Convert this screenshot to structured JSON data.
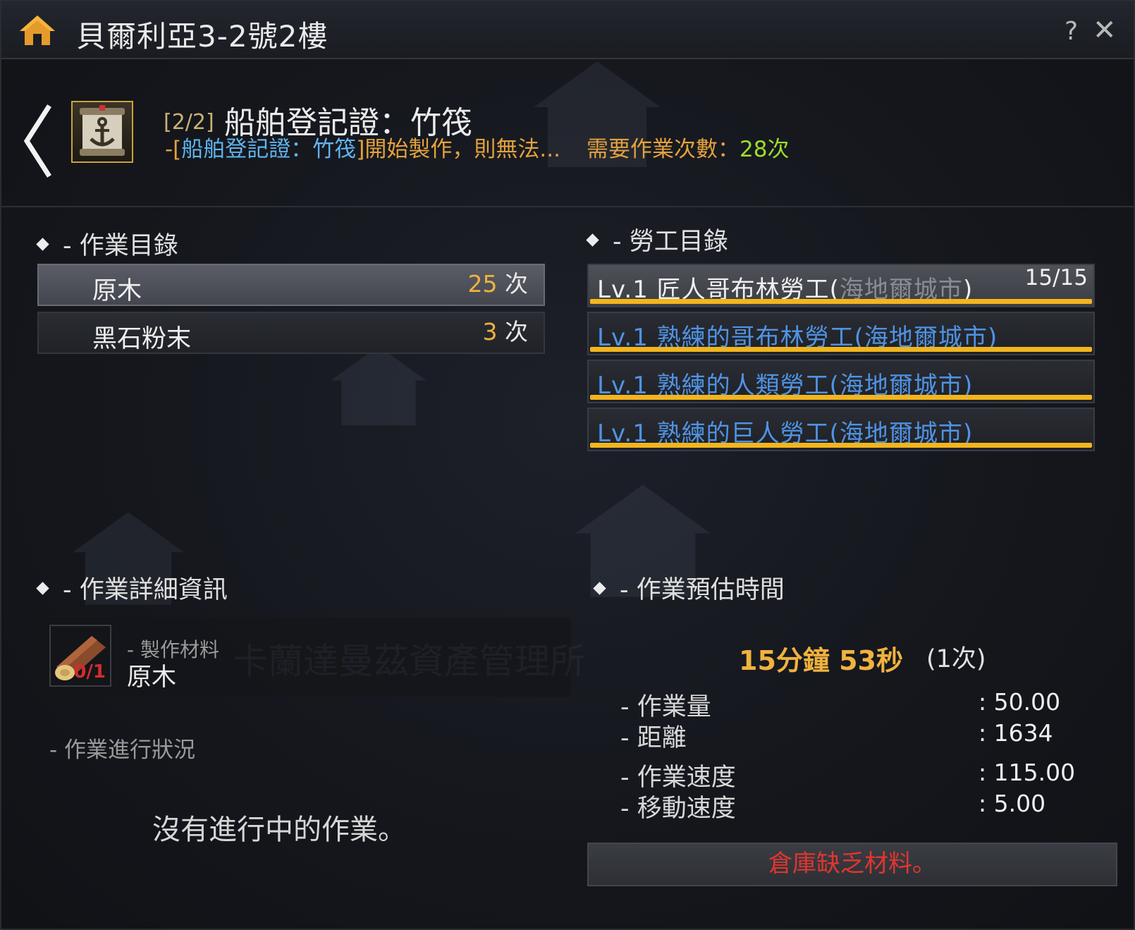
{
  "window": {
    "title": "貝爾利亞3-2號2樓",
    "help": "?",
    "close": "✕"
  },
  "header": {
    "count": "[2/2]",
    "item_name": "船舶登記證：竹筏",
    "desc_prefix": "-[",
    "desc_link": "船舶登記證：竹筏",
    "desc_rest": "]開始製作，則無法...",
    "required_label": "需要作業次數：",
    "required_value": "28次"
  },
  "work_list": {
    "title": "- 作業目錄",
    "items": [
      {
        "name": "原木",
        "count": "25",
        "unit": "次"
      },
      {
        "name": "黑石粉末",
        "count": "3",
        "unit": "次"
      }
    ]
  },
  "worker_list": {
    "title": "- 勞工目錄",
    "slots": "15/15",
    "items": [
      {
        "label": "Lv.1 匠人哥布林勞工(",
        "city": "海地爾城市",
        "close": ")"
      },
      {
        "label": "Lv.1 熟練的哥布林勞工(",
        "city": "海地爾城市",
        "close": ")"
      },
      {
        "label": "Lv.1 熟練的人類勞工(",
        "city": "海地爾城市",
        "close": ")"
      },
      {
        "label": "Lv.1 熟練的巨人勞工(",
        "city": "海地爾城市",
        "close": ")"
      }
    ]
  },
  "details": {
    "title": "- 作業詳細資訊",
    "material_sub": "- 製作材料",
    "material_name": "原木",
    "material_qty": "0/1",
    "watermark": "卡蘭達曼茲資產管理所",
    "progress_label": "- 作業進行狀況",
    "no_work": "沒有進行中的作業。"
  },
  "time": {
    "title": "- 作業預估時間",
    "value": "15分鐘 53秒",
    "count": "(1次)",
    "stats": [
      {
        "label": "- 作業量",
        "value": ": 50.00"
      },
      {
        "label": "- 距離",
        "value": ": 1634"
      },
      {
        "label": "- 作業速度",
        "value": ": 115.00"
      },
      {
        "label": "- 移動速度",
        "value": ": 5.00"
      }
    ],
    "warning": "倉庫缺乏材料。"
  },
  "icons": [
    "home-icon",
    "back-chevron-icon",
    "anchor-scroll-icon",
    "log-icon"
  ],
  "colors": {
    "accent_gold": "#f0b23e",
    "link_blue": "#4f93e4",
    "warning_red": "#e0362e",
    "bar_yellow": "#f2b51d"
  }
}
